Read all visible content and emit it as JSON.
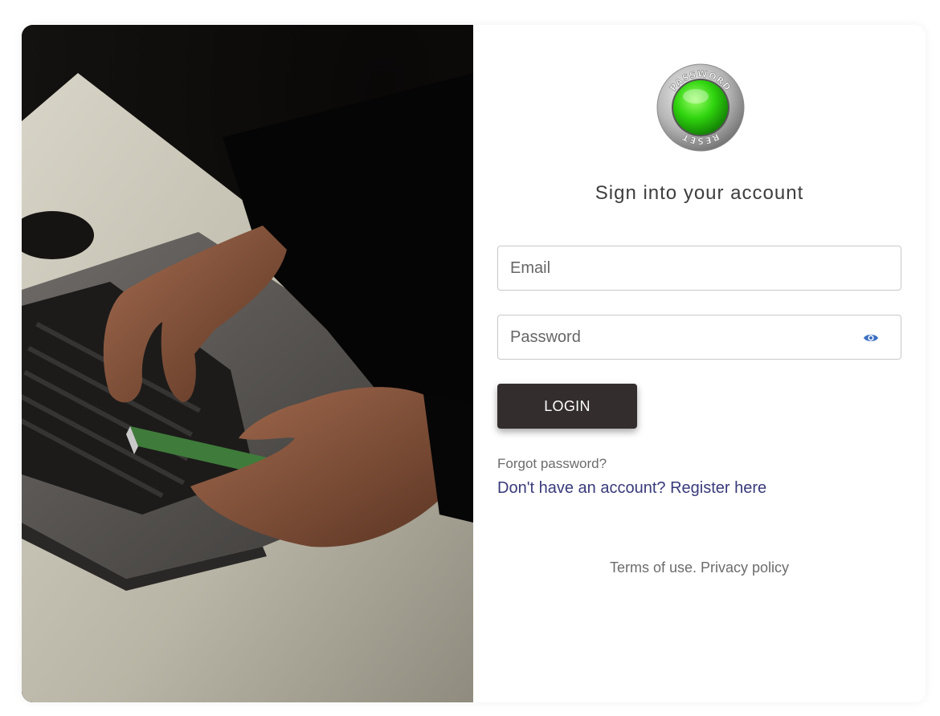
{
  "page": {
    "title": "Sign into your account"
  },
  "logo": {
    "top_text": "PASSWORD",
    "bottom_text": "RESET"
  },
  "form": {
    "email_placeholder": "Email",
    "email_value": "",
    "password_placeholder": "Password",
    "password_value": "",
    "login_label": "LOGIN",
    "eye_icon": "eye-icon"
  },
  "links": {
    "forgot_password": "Forgot password?",
    "register": "Don't have an account? Register here"
  },
  "footer": {
    "terms": "Terms of use.",
    "privacy": "Privacy policy"
  },
  "colors": {
    "button_bg": "#332d2d",
    "link_color": "#383a7a",
    "eye_icon": "#3b6fc4",
    "logo_green": "#22c40a"
  }
}
